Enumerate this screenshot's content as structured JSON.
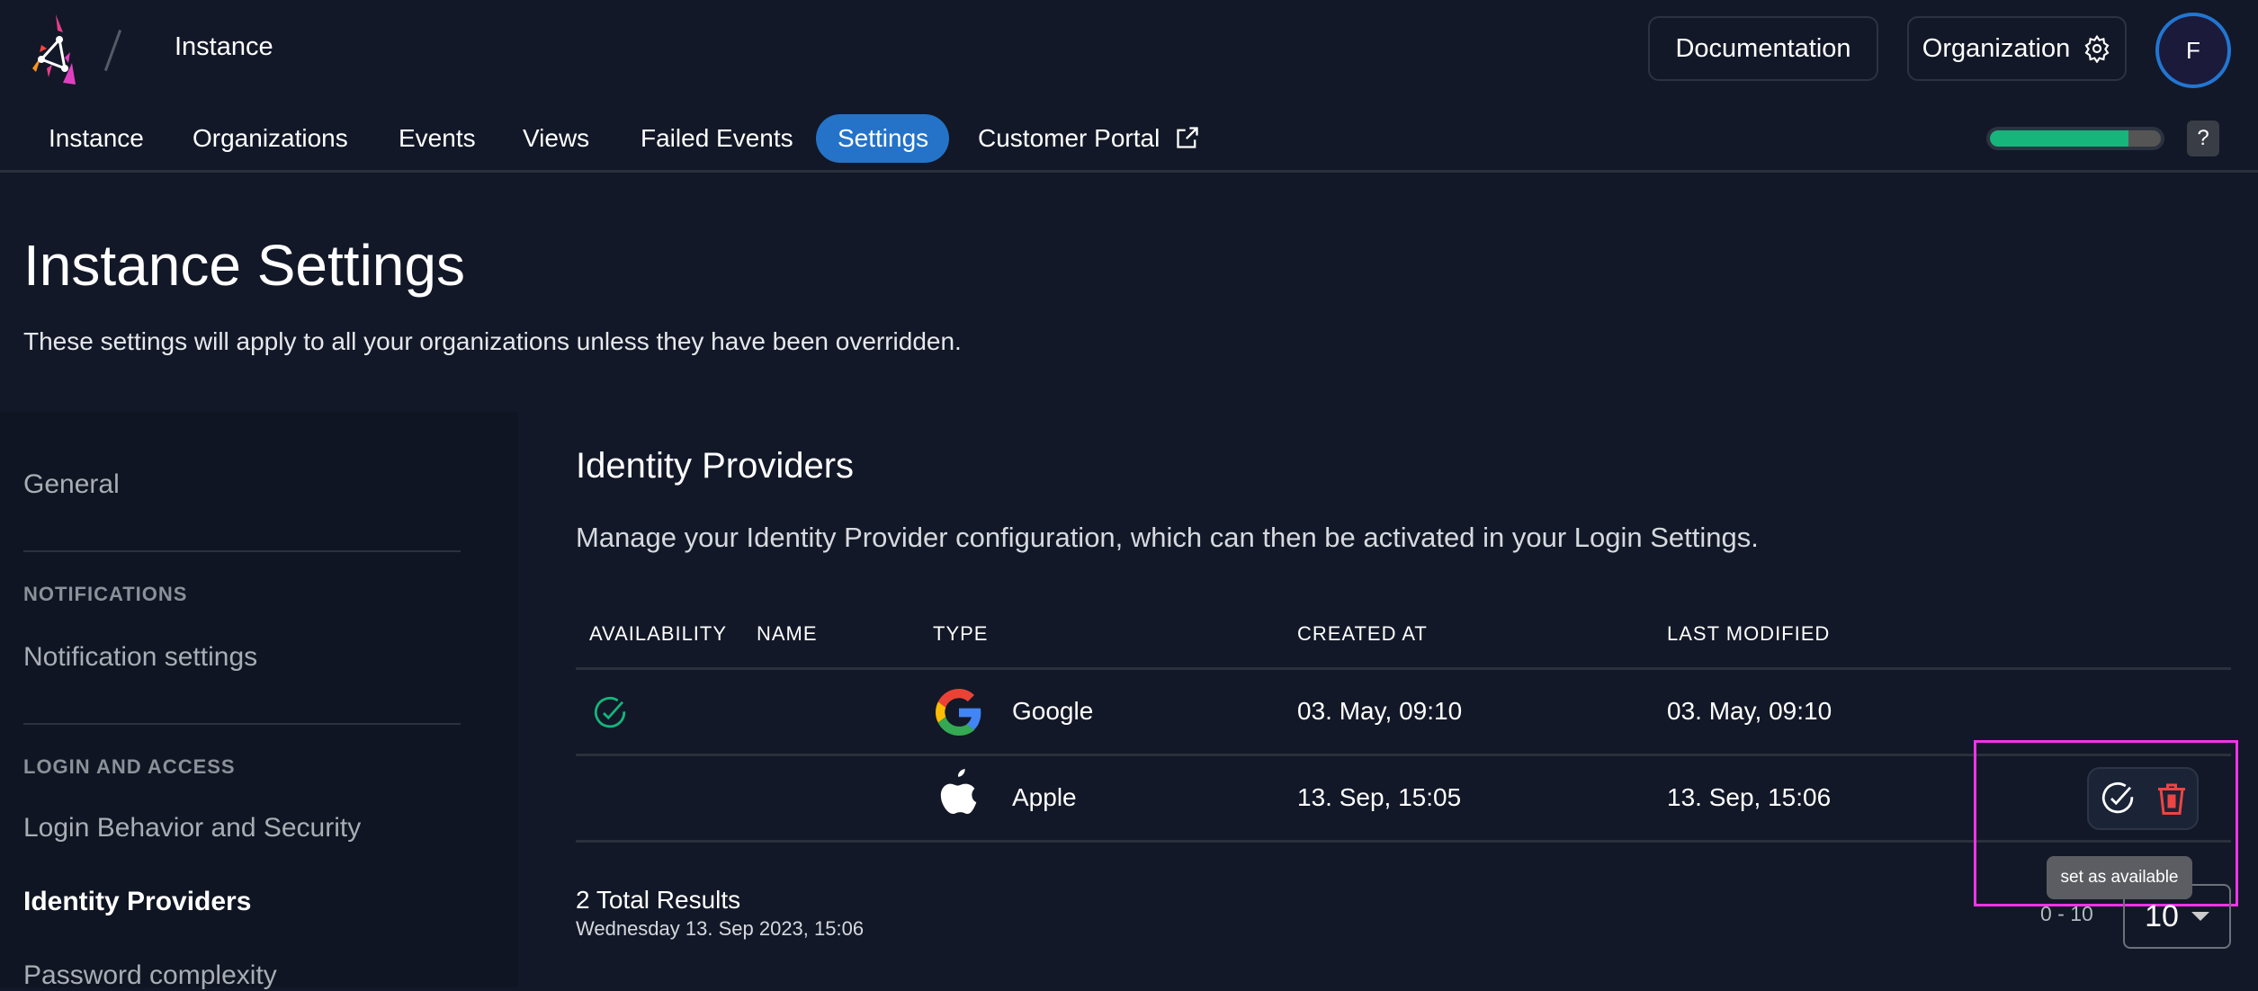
{
  "header": {
    "breadcrumb": "Instance",
    "documentation_label": "Documentation",
    "organization_label": "Organization",
    "avatar_initial": "F"
  },
  "nav": {
    "items": [
      {
        "label": "Instance"
      },
      {
        "label": "Organizations"
      },
      {
        "label": "Events"
      },
      {
        "label": "Views"
      },
      {
        "label": "Failed Events"
      },
      {
        "label": "Settings",
        "active": true
      },
      {
        "label": "Customer Portal",
        "external": true
      }
    ],
    "progress_percent": 81,
    "help_label": "?"
  },
  "page": {
    "title": "Instance Settings",
    "subtitle": "These settings will apply to all your organizations unless they have been overridden."
  },
  "sidebar": {
    "general": "General",
    "notifications_header": "NOTIFICATIONS",
    "notification_settings": "Notification settings",
    "login_header": "LOGIN AND ACCESS",
    "login_behavior": "Login Behavior and Security",
    "identity_providers": "Identity Providers",
    "password_complexity": "Password complexity"
  },
  "main": {
    "title": "Identity Providers",
    "description": "Manage your Identity Provider configuration, which can then be activated in your Login Settings.",
    "columns": [
      "AVAILABILITY",
      "NAME",
      "TYPE",
      "CREATED AT",
      "LAST MODIFIED"
    ],
    "rows": [
      {
        "available": true,
        "name": "",
        "type": "Google",
        "created": "03. May, 09:10",
        "modified": "03. May, 09:10"
      },
      {
        "available": false,
        "name": "",
        "type": "Apple",
        "created": "13. Sep, 15:05",
        "modified": "13. Sep, 15:06"
      }
    ],
    "tooltip": "set as available",
    "total": "2 Total Results",
    "timestamp": "Wednesday 13. Sep 2023, 15:06",
    "range": "0 - 10",
    "page_size": "10"
  },
  "colors": {
    "accent": "#2473c8",
    "success": "#15b57c",
    "danger": "#ef4444",
    "highlight": "#f233e8"
  }
}
